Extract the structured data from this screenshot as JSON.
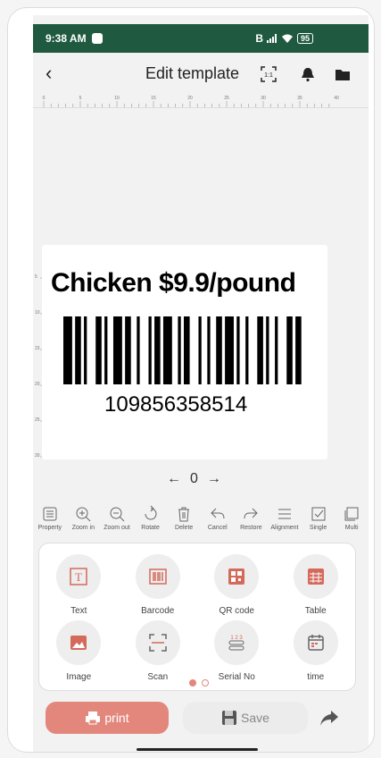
{
  "status": {
    "time": "9:38 AM",
    "battery": "95",
    "network": "B"
  },
  "header": {
    "title": "Edit template"
  },
  "label": {
    "text": "Chicken $9.9/pound",
    "barcode_number": "109856358514"
  },
  "pager": {
    "prev": "←",
    "value": "0",
    "next": "→"
  },
  "toolbar": [
    {
      "label": "Property",
      "icon": "list-icon"
    },
    {
      "label": "Zoom in",
      "icon": "zoom-in-icon"
    },
    {
      "label": "Zoom out",
      "icon": "zoom-out-icon"
    },
    {
      "label": "Rotate",
      "icon": "rotate-icon"
    },
    {
      "label": "Delete",
      "icon": "trash-icon"
    },
    {
      "label": "Cancel",
      "icon": "undo-icon"
    },
    {
      "label": "Restore",
      "icon": "redo-icon"
    },
    {
      "label": "Alignment",
      "icon": "align-icon"
    },
    {
      "label": "Single",
      "icon": "checkbox-icon"
    },
    {
      "label": "Multi",
      "icon": "multi-select-icon"
    }
  ],
  "elements": [
    {
      "label": "Text",
      "icon": "text-icon"
    },
    {
      "label": "Barcode",
      "icon": "barcode-icon"
    },
    {
      "label": "QR code",
      "icon": "qr-code-icon"
    },
    {
      "label": "Table",
      "icon": "table-icon"
    },
    {
      "label": "Image",
      "icon": "image-icon"
    },
    {
      "label": "Scan",
      "icon": "scan-icon"
    },
    {
      "label": "Serial No",
      "icon": "serial-number-icon"
    },
    {
      "label": "time",
      "icon": "calendar-icon"
    }
  ],
  "buttons": {
    "print": "print",
    "save": "Save"
  },
  "colors": {
    "statusbar": "#1f5a40",
    "print": "#e3877d",
    "active_dot": "#e3877d"
  },
  "ruler": {
    "h_ticks": [
      "0",
      "5",
      "10",
      "15",
      "20",
      "25",
      "30",
      "35",
      "40"
    ],
    "v_ticks": [
      "5",
      "10",
      "15",
      "20",
      "25",
      "30"
    ]
  }
}
